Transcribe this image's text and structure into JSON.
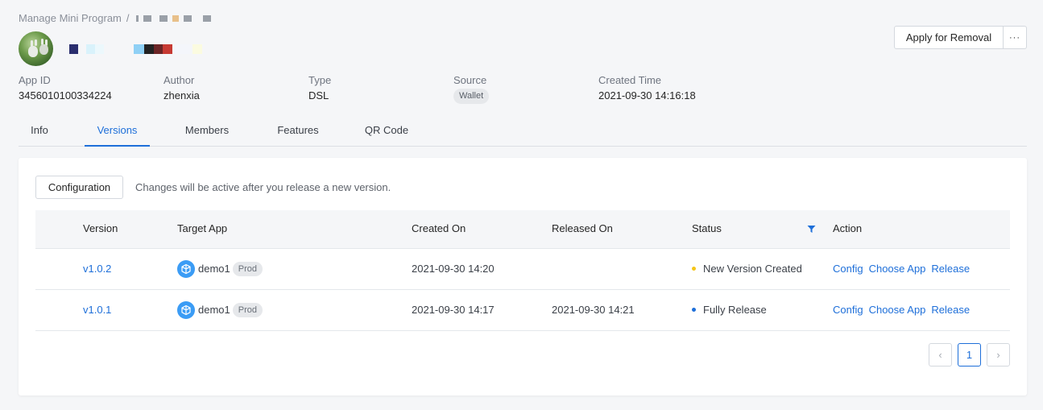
{
  "breadcrumb": {
    "root": "Manage Mini Program",
    "separator": "/"
  },
  "header": {
    "removal_label": "Apply for Removal",
    "more_label": "···"
  },
  "meta": [
    {
      "label": "App ID",
      "value": "3456010100334224"
    },
    {
      "label": "Author",
      "value": "zhenxia"
    },
    {
      "label": "Type",
      "value": "DSL"
    },
    {
      "label": "Source",
      "value": "Wallet"
    },
    {
      "label": "Created Time",
      "value": "2021-09-30 14:16:18"
    }
  ],
  "tabs": [
    "Info",
    "Versions",
    "Members",
    "Features",
    "QR Code"
  ],
  "active_tab": "Versions",
  "versions": {
    "config_label": "Configuration",
    "config_hint": "Changes will be active after you release a new version.",
    "columns": [
      "Version",
      "Target App",
      "Created On",
      "Released On",
      "Status",
      "Action"
    ],
    "rows": [
      {
        "version": "v1.0.2",
        "app": "demo1",
        "env": "Prod",
        "created_on": "2021-09-30 14:20",
        "released_on": "",
        "status": "New Version Created",
        "status_color": "#f5c518",
        "actions": [
          "Config",
          "Choose App",
          "Release"
        ]
      },
      {
        "version": "v1.0.1",
        "app": "demo1",
        "env": "Prod",
        "created_on": "2021-09-30 14:17",
        "released_on": "2021-09-30 14:21",
        "status": "Fully Release",
        "status_color": "#1e6fd9",
        "actions": [
          "Config",
          "Choose App",
          "Release"
        ]
      }
    ]
  },
  "pagination": {
    "prev": "‹",
    "current": "1",
    "next": "›"
  },
  "colors": {
    "accent": "#1e6fd9",
    "background": "#f5f6f8"
  }
}
